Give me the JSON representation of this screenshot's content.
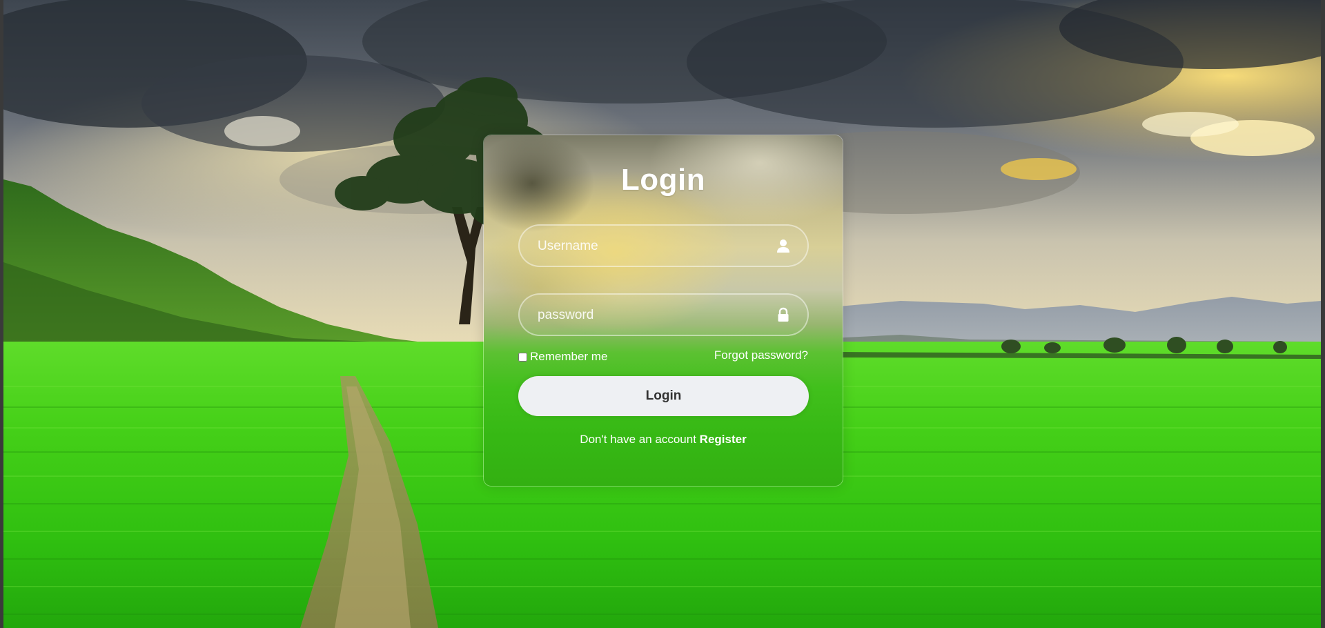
{
  "login_card": {
    "title": "Login",
    "username": {
      "placeholder": "Username",
      "value": "",
      "icon": "user-icon"
    },
    "password": {
      "placeholder": "password",
      "value": "",
      "icon": "lock-icon"
    },
    "remember_label": "Remember me",
    "remember_checked": false,
    "forgot_label": "Forgot password?",
    "submit_label": "Login",
    "register_prompt": "Don't have an account",
    "register_link": "Register"
  },
  "colors": {
    "card_text": "#ffffff",
    "button_bg": "#eef0f3",
    "button_text": "#333333"
  }
}
